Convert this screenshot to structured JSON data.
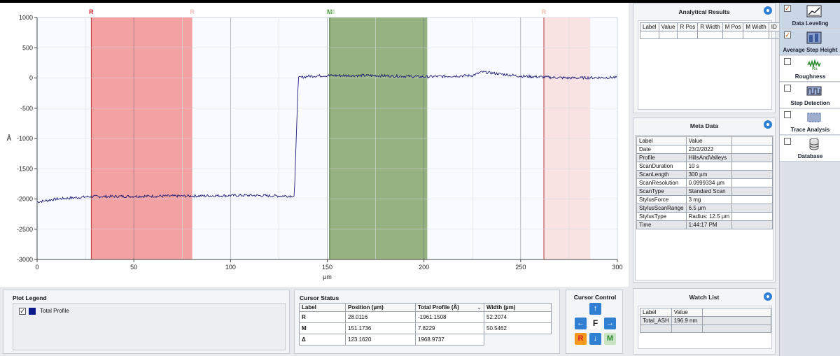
{
  "chart_data": {
    "type": "line",
    "xlabel": "µm",
    "ylabel": "Å",
    "xlim": [
      0,
      300
    ],
    "ylim": [
      -3000,
      1000
    ],
    "x_ticks": [
      "0",
      "50",
      "100",
      "150",
      "200",
      "250",
      "300"
    ],
    "y_ticks": [
      "1000",
      "500",
      "0",
      "-500",
      "-1000",
      "-1500",
      "-2000",
      "-2500",
      "-3000"
    ],
    "series": [
      {
        "name": "Total Profile",
        "color": "#1c1a78",
        "x": [
          0,
          10,
          28,
          50,
          80,
          110,
          125,
          133,
          135,
          140,
          150,
          175,
          200,
          225,
          230,
          250,
          275,
          300
        ],
        "y": [
          -2050,
          -2000,
          -1960,
          -1955,
          -1950,
          -1940,
          -1950,
          -1950,
          0,
          30,
          40,
          40,
          20,
          40,
          100,
          30,
          0,
          10
        ]
      }
    ],
    "regions": [
      {
        "label": "R",
        "x0": 28.0,
        "x1": 80.2,
        "color": "#f29c9c"
      },
      {
        "label": "M",
        "x0": 151.2,
        "x1": 201.7,
        "color": "#8fae79"
      },
      {
        "label": "R",
        "x0": 262.0,
        "x1": 286.0,
        "color": "#f9e0e0"
      }
    ],
    "region_markers": [
      {
        "text": "R",
        "x": 28.0,
        "color": "#d7202a"
      },
      {
        "text": "R",
        "x": 80.2,
        "color": "#f3b9b9"
      },
      {
        "text": "M",
        "x": 151.2,
        "color": "#3f8f2f"
      },
      {
        "text": "M",
        "x": 152.5,
        "color": "#a9d59e"
      },
      {
        "text": "R",
        "x": 262.0,
        "color": "#f3b9b9"
      }
    ]
  },
  "analytical_results": {
    "title": "Analytical Results",
    "columns": [
      "Label",
      "Value",
      "R Pos",
      "R Width",
      "M Pos",
      "M Width",
      "ID"
    ],
    "rows": [
      [
        "",
        "",
        "",
        "",
        "",
        "",
        ""
      ]
    ]
  },
  "meta_data": {
    "title": "Meta Data",
    "columns": [
      "Label",
      "Value"
    ],
    "rows": [
      [
        "Date",
        "23/2/2022"
      ],
      [
        "Profile",
        "HillsAndValleys"
      ],
      [
        "ScanDuration",
        "10 s"
      ],
      [
        "ScanLength",
        "300 µm"
      ],
      [
        "ScanResolution",
        "0.0999334 µm"
      ],
      [
        "ScanType",
        "Standard Scan"
      ],
      [
        "StylusForce",
        "3 mg"
      ],
      [
        "StylusScanRange",
        "6.5 µm"
      ],
      [
        "StylusType",
        "Radius: 12.5 µm"
      ],
      [
        "Time",
        "1:44:17 PM"
      ]
    ]
  },
  "watch_list": {
    "title": "Watch List",
    "columns": [
      "Label",
      "Value"
    ],
    "rows": [
      [
        "Total_ASH",
        "196.9 nm"
      ]
    ]
  },
  "plot_legend": {
    "title": "Plot Legend",
    "items": [
      {
        "label": "Total Profile",
        "checked": true,
        "color": "#0a1a8a"
      }
    ]
  },
  "cursor_status": {
    "title": "Cursor Status",
    "columns": [
      "Label",
      "Position (µm)",
      "Total Profile (Å)",
      "Width (µm)"
    ],
    "rows": [
      [
        "R",
        "28.0116",
        "-1961.1508",
        "52.2074"
      ],
      [
        "M",
        "151.1736",
        "7.8229",
        "50.5462"
      ],
      [
        "Δ",
        "123.1620",
        "1968.9737",
        ""
      ]
    ]
  },
  "cursor_control": {
    "title": "Cursor Control",
    "center": "F",
    "r_label": "R",
    "m_label": "M"
  },
  "toolbar": {
    "items": [
      {
        "label": "Data Leveling",
        "checked": true,
        "icon": "data-leveling-icon"
      },
      {
        "label": "Average Step Height",
        "checked": true,
        "icon": "step-height-icon"
      },
      {
        "label": "Roughness",
        "checked": false,
        "icon": "roughness-icon"
      },
      {
        "label": "Step Detection",
        "checked": false,
        "icon": "step-detection-icon"
      },
      {
        "label": "Trace Analysis",
        "checked": false,
        "icon": "trace-analysis-icon"
      },
      {
        "label": "Database",
        "checked": false,
        "icon": "database-icon"
      }
    ]
  }
}
